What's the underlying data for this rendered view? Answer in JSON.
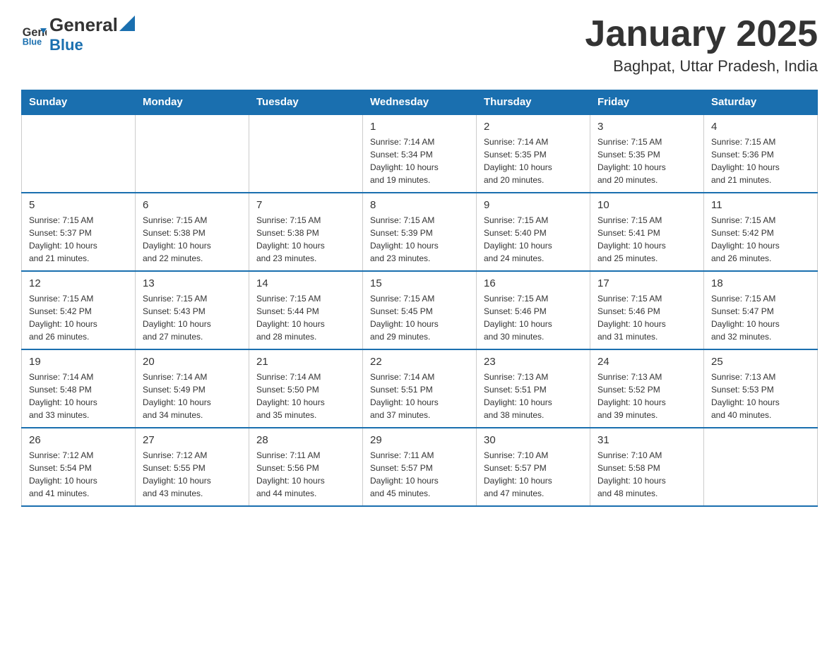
{
  "header": {
    "logo_text_general": "General",
    "logo_text_blue": "Blue",
    "month_title": "January 2025",
    "location": "Baghpat, Uttar Pradesh, India"
  },
  "days_of_week": [
    "Sunday",
    "Monday",
    "Tuesday",
    "Wednesday",
    "Thursday",
    "Friday",
    "Saturday"
  ],
  "weeks": [
    [
      {
        "day": "",
        "info": ""
      },
      {
        "day": "",
        "info": ""
      },
      {
        "day": "",
        "info": ""
      },
      {
        "day": "1",
        "info": "Sunrise: 7:14 AM\nSunset: 5:34 PM\nDaylight: 10 hours\nand 19 minutes."
      },
      {
        "day": "2",
        "info": "Sunrise: 7:14 AM\nSunset: 5:35 PM\nDaylight: 10 hours\nand 20 minutes."
      },
      {
        "day": "3",
        "info": "Sunrise: 7:15 AM\nSunset: 5:35 PM\nDaylight: 10 hours\nand 20 minutes."
      },
      {
        "day": "4",
        "info": "Sunrise: 7:15 AM\nSunset: 5:36 PM\nDaylight: 10 hours\nand 21 minutes."
      }
    ],
    [
      {
        "day": "5",
        "info": "Sunrise: 7:15 AM\nSunset: 5:37 PM\nDaylight: 10 hours\nand 21 minutes."
      },
      {
        "day": "6",
        "info": "Sunrise: 7:15 AM\nSunset: 5:38 PM\nDaylight: 10 hours\nand 22 minutes."
      },
      {
        "day": "7",
        "info": "Sunrise: 7:15 AM\nSunset: 5:38 PM\nDaylight: 10 hours\nand 23 minutes."
      },
      {
        "day": "8",
        "info": "Sunrise: 7:15 AM\nSunset: 5:39 PM\nDaylight: 10 hours\nand 23 minutes."
      },
      {
        "day": "9",
        "info": "Sunrise: 7:15 AM\nSunset: 5:40 PM\nDaylight: 10 hours\nand 24 minutes."
      },
      {
        "day": "10",
        "info": "Sunrise: 7:15 AM\nSunset: 5:41 PM\nDaylight: 10 hours\nand 25 minutes."
      },
      {
        "day": "11",
        "info": "Sunrise: 7:15 AM\nSunset: 5:42 PM\nDaylight: 10 hours\nand 26 minutes."
      }
    ],
    [
      {
        "day": "12",
        "info": "Sunrise: 7:15 AM\nSunset: 5:42 PM\nDaylight: 10 hours\nand 26 minutes."
      },
      {
        "day": "13",
        "info": "Sunrise: 7:15 AM\nSunset: 5:43 PM\nDaylight: 10 hours\nand 27 minutes."
      },
      {
        "day": "14",
        "info": "Sunrise: 7:15 AM\nSunset: 5:44 PM\nDaylight: 10 hours\nand 28 minutes."
      },
      {
        "day": "15",
        "info": "Sunrise: 7:15 AM\nSunset: 5:45 PM\nDaylight: 10 hours\nand 29 minutes."
      },
      {
        "day": "16",
        "info": "Sunrise: 7:15 AM\nSunset: 5:46 PM\nDaylight: 10 hours\nand 30 minutes."
      },
      {
        "day": "17",
        "info": "Sunrise: 7:15 AM\nSunset: 5:46 PM\nDaylight: 10 hours\nand 31 minutes."
      },
      {
        "day": "18",
        "info": "Sunrise: 7:15 AM\nSunset: 5:47 PM\nDaylight: 10 hours\nand 32 minutes."
      }
    ],
    [
      {
        "day": "19",
        "info": "Sunrise: 7:14 AM\nSunset: 5:48 PM\nDaylight: 10 hours\nand 33 minutes."
      },
      {
        "day": "20",
        "info": "Sunrise: 7:14 AM\nSunset: 5:49 PM\nDaylight: 10 hours\nand 34 minutes."
      },
      {
        "day": "21",
        "info": "Sunrise: 7:14 AM\nSunset: 5:50 PM\nDaylight: 10 hours\nand 35 minutes."
      },
      {
        "day": "22",
        "info": "Sunrise: 7:14 AM\nSunset: 5:51 PM\nDaylight: 10 hours\nand 37 minutes."
      },
      {
        "day": "23",
        "info": "Sunrise: 7:13 AM\nSunset: 5:51 PM\nDaylight: 10 hours\nand 38 minutes."
      },
      {
        "day": "24",
        "info": "Sunrise: 7:13 AM\nSunset: 5:52 PM\nDaylight: 10 hours\nand 39 minutes."
      },
      {
        "day": "25",
        "info": "Sunrise: 7:13 AM\nSunset: 5:53 PM\nDaylight: 10 hours\nand 40 minutes."
      }
    ],
    [
      {
        "day": "26",
        "info": "Sunrise: 7:12 AM\nSunset: 5:54 PM\nDaylight: 10 hours\nand 41 minutes."
      },
      {
        "day": "27",
        "info": "Sunrise: 7:12 AM\nSunset: 5:55 PM\nDaylight: 10 hours\nand 43 minutes."
      },
      {
        "day": "28",
        "info": "Sunrise: 7:11 AM\nSunset: 5:56 PM\nDaylight: 10 hours\nand 44 minutes."
      },
      {
        "day": "29",
        "info": "Sunrise: 7:11 AM\nSunset: 5:57 PM\nDaylight: 10 hours\nand 45 minutes."
      },
      {
        "day": "30",
        "info": "Sunrise: 7:10 AM\nSunset: 5:57 PM\nDaylight: 10 hours\nand 47 minutes."
      },
      {
        "day": "31",
        "info": "Sunrise: 7:10 AM\nSunset: 5:58 PM\nDaylight: 10 hours\nand 48 minutes."
      },
      {
        "day": "",
        "info": ""
      }
    ]
  ]
}
